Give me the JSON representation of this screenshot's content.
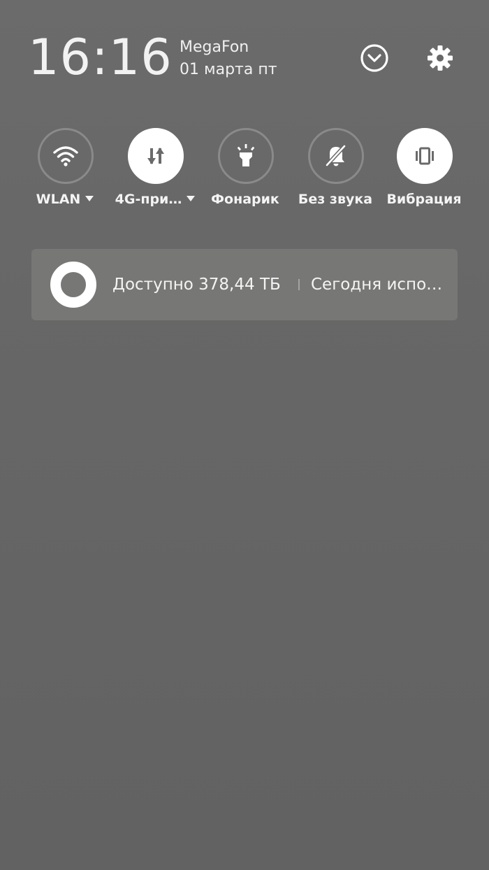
{
  "header": {
    "time": "16:16",
    "carrier": "MegaFon",
    "date": "01 марта пт"
  },
  "quick_toggles": [
    {
      "label": "WLAN",
      "icon": "wifi-icon",
      "active": false,
      "has_menu": true
    },
    {
      "label": "4G-при…",
      "icon": "mobile-data-icon",
      "active": true,
      "has_menu": true
    },
    {
      "label": "Фонарик",
      "icon": "flashlight-icon",
      "active": false,
      "has_menu": false
    },
    {
      "label": "Без звука",
      "icon": "bell-off-icon",
      "active": false,
      "has_menu": false
    },
    {
      "label": "Вибрация",
      "icon": "vibrate-icon",
      "active": true,
      "has_menu": false
    }
  ],
  "storage_card": {
    "available": "Доступно 378,44 ТБ",
    "today": "Сегодня использовано"
  },
  "colors": {
    "background": "#646464",
    "card": "#777775",
    "active_toggle": "#ffffff",
    "inactive_ring": "#8a8a8a"
  }
}
